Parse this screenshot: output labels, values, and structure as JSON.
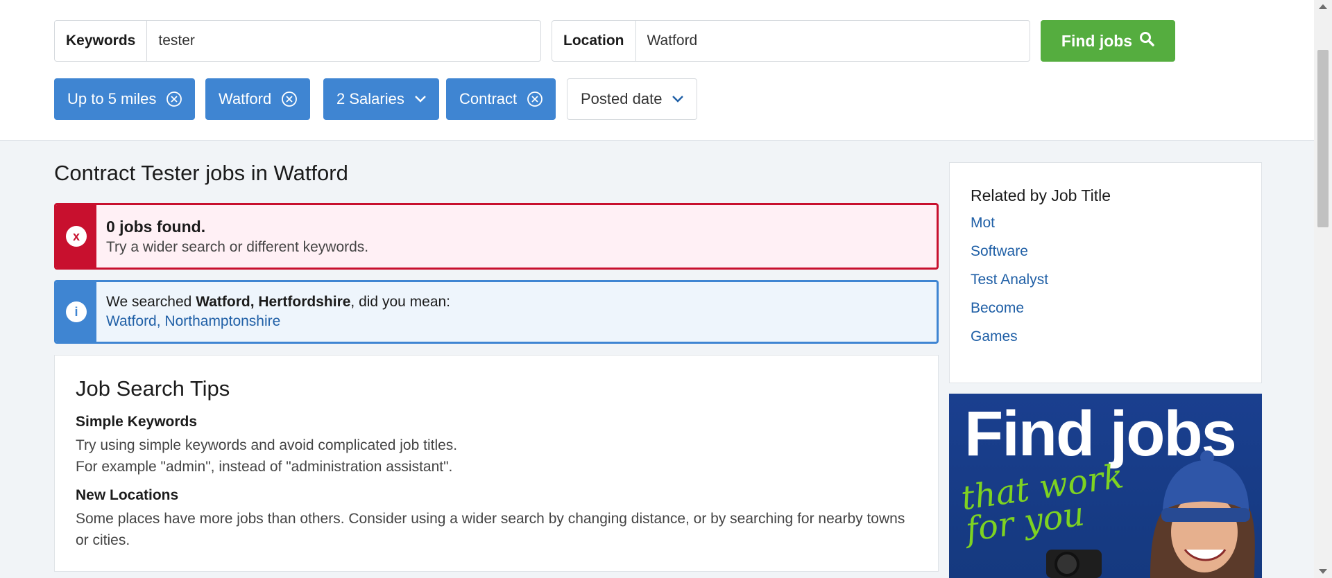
{
  "search": {
    "keywords_label": "Keywords",
    "keywords_value": "tester",
    "location_label": "Location",
    "location_value": "Watford",
    "find_button": "Find jobs"
  },
  "filters": [
    {
      "label": "Up to 5 miles",
      "type": "remove"
    },
    {
      "label": "Watford",
      "type": "remove"
    },
    {
      "label": "2 Salaries",
      "type": "dropdown"
    },
    {
      "label": "Contract",
      "type": "remove"
    },
    {
      "label": "Posted date",
      "type": "dropdown"
    }
  ],
  "page_title": "Contract Tester jobs in Watford",
  "error_alert": {
    "icon": "x",
    "heading": "0 jobs found.",
    "message": "Try a wider search or different keywords."
  },
  "info_alert": {
    "icon": "i",
    "prefix": "We searched ",
    "searched_place": "Watford, Hertfordshire",
    "suffix": ", did you mean:",
    "suggestion": "Watford, Northamptonshire"
  },
  "tips": {
    "title": "Job Search Tips",
    "sections": [
      {
        "heading": "Simple Keywords",
        "lines": [
          "Try using simple keywords and avoid complicated job titles.",
          "For example \"admin\", instead of \"administration assistant\"."
        ]
      },
      {
        "heading": "New Locations",
        "lines": [
          "Some places have more jobs than others. Consider using a wider search by changing distance, or by searching for nearby towns or cities."
        ]
      }
    ]
  },
  "related": {
    "title": "Related by Job Title",
    "links": [
      "Mot",
      "Software",
      "Test Analyst",
      "Become",
      "Games"
    ]
  },
  "ad": {
    "headline": "Find jobs",
    "tagline_1": "that work",
    "tagline_2": "for you"
  },
  "colors": {
    "accent_blue": "#3f85d2",
    "find_green": "#55ad3f",
    "error_red": "#c8102e",
    "link_blue": "#1f5fa6"
  }
}
